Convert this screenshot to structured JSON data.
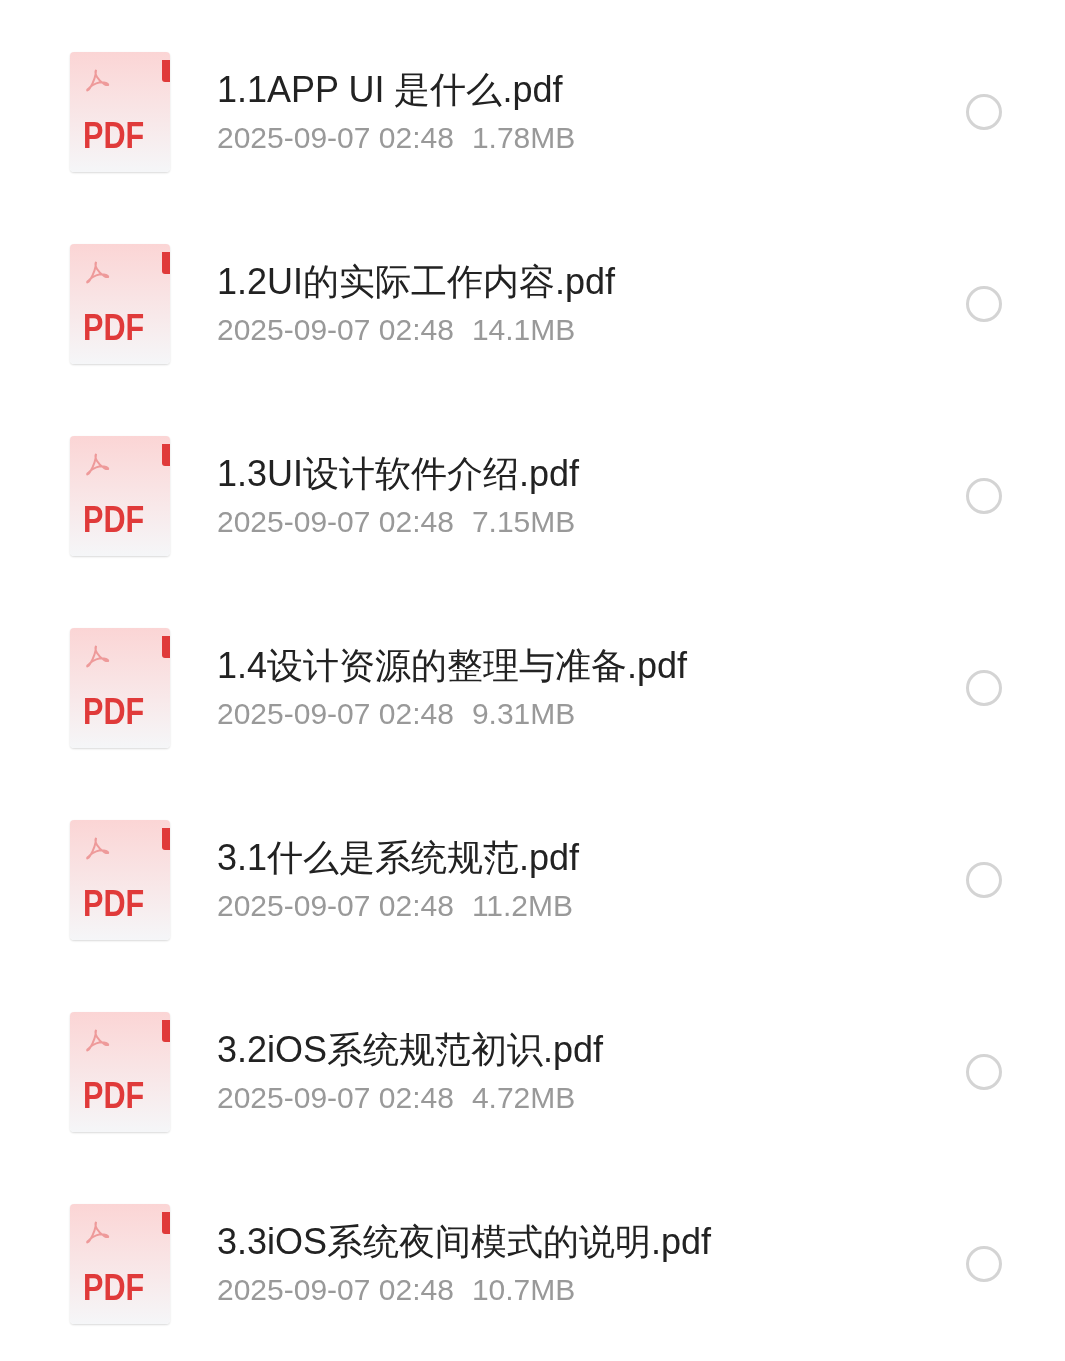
{
  "files": [
    {
      "badge": "PDF",
      "name": "1.1APP UI 是什么.pdf",
      "date": "2025-09-07 02:48",
      "size": "1.78MB",
      "selected": false
    },
    {
      "badge": "PDF",
      "name": "1.2UI的实际工作内容.pdf",
      "date": "2025-09-07 02:48",
      "size": "14.1MB",
      "selected": false
    },
    {
      "badge": "PDF",
      "name": "1.3UI设计软件介绍.pdf",
      "date": "2025-09-07 02:48",
      "size": "7.15MB",
      "selected": false
    },
    {
      "badge": "PDF",
      "name": "1.4设计资源的整理与准备.pdf",
      "date": "2025-09-07 02:48",
      "size": "9.31MB",
      "selected": false
    },
    {
      "badge": "PDF",
      "name": "3.1什么是系统规范.pdf",
      "date": "2025-09-07 02:48",
      "size": "11.2MB",
      "selected": false
    },
    {
      "badge": "PDF",
      "name": "3.2iOS系统规范初识.pdf",
      "date": "2025-09-07 02:48",
      "size": "4.72MB",
      "selected": false
    },
    {
      "badge": "PDF",
      "name": "3.3iOS系统夜间模式的说明.pdf",
      "date": "2025-09-07 02:48",
      "size": "10.7MB",
      "selected": false
    }
  ]
}
